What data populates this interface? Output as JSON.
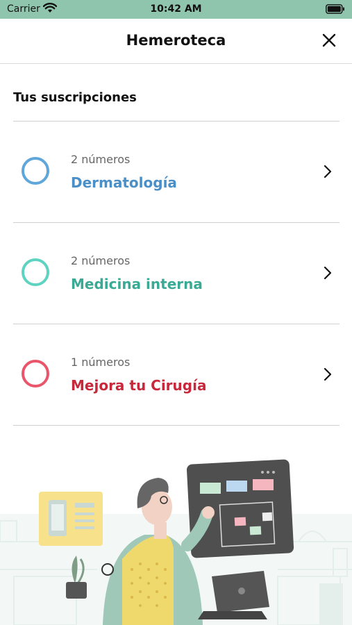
{
  "status_bar": {
    "carrier": "Carrier",
    "time": "10:42 AM"
  },
  "header": {
    "title": "Hemeroteca",
    "close_icon": "close-icon"
  },
  "section": {
    "title": "Tus suscripciones"
  },
  "subscriptions": [
    {
      "count": "2 números",
      "name": "Dermatología",
      "color": "#4a8fc7",
      "ring_color": "#5fa6da"
    },
    {
      "count": "2 números",
      "name": "Medicina interna",
      "color": "#3aaa94",
      "ring_color": "#5fd3c2"
    },
    {
      "count": "1 números",
      "name": "Mejora tu Cirugía",
      "color": "#c8283c",
      "ring_color": "#e9566b"
    }
  ]
}
